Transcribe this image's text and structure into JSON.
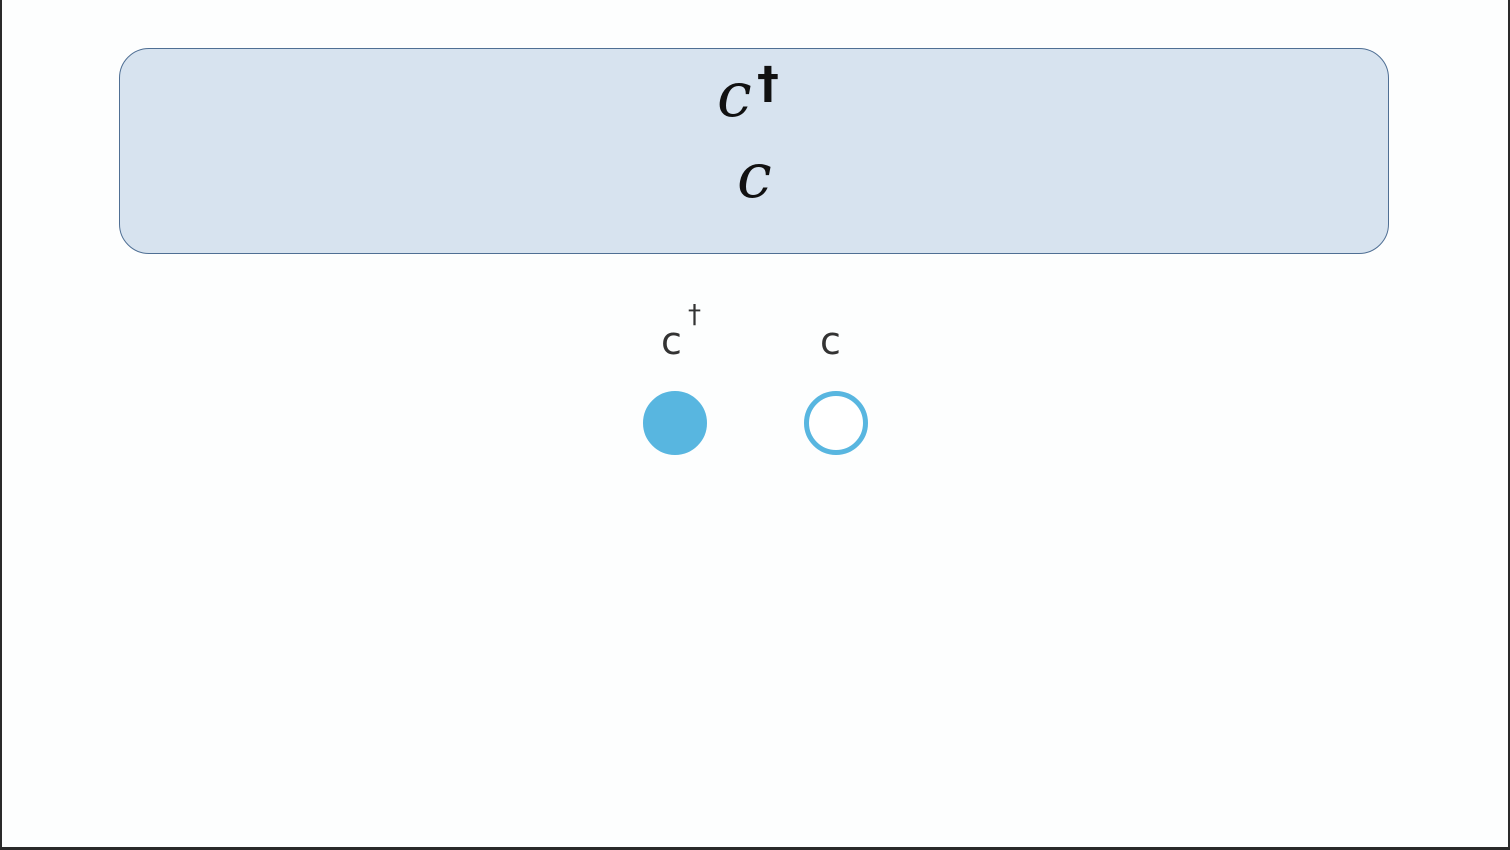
{
  "formula_box": {
    "line1": {
      "symbol": "c",
      "superscript": "†"
    },
    "line2": {
      "symbol": "c"
    }
  },
  "modes": [
    {
      "label": "c",
      "superscript": "†",
      "state": "filled"
    },
    {
      "label": "c",
      "superscript": "",
      "state": "empty"
    }
  ],
  "colors": {
    "box_fill": "#d7e3ef",
    "box_border": "#4f6f94",
    "dot": "#58b6e0"
  }
}
